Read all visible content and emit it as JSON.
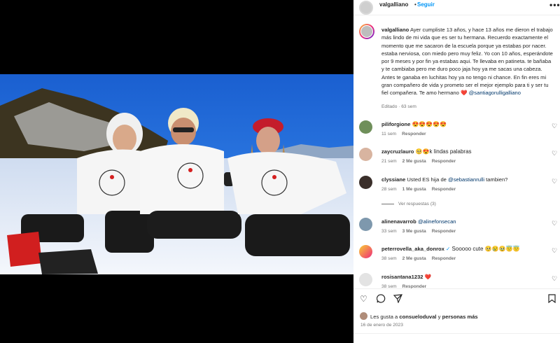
{
  "post": {
    "username": "valgalliano",
    "separator": "•",
    "follow_label": "Seguir",
    "more_label": "•••",
    "caption_user": "valgalliano",
    "caption_text": "Ayer cumpliste 13 años, y hace 13 años me dieron el trabajo más lindo de mi vida que es ser tu hermana. Recuerdo exactamente el momento que me sacaron de la escuela porque ya estabas por nacer. estaba nerviosa, con miedo pero muy feliz. Yo con 10 años, esperándote por 9 meses y por fin ya estabas aqui. Te llevaba en patineta. te bañaba y te cambiaba pero me duro poco jaja hoy ya me sacas una cabeza. Antes te ganaba en luchitas hoy ya no tengo ni chance. En fin eres mi gran compañero de vida y prometo ser el mejor ejemplo para ti y ser tu fiel compañera. Te amo hermano",
    "caption_heart": "❤️",
    "caption_mention": "@santiagorulligalliano",
    "caption_meta": "Editado · 63 sem"
  },
  "comments": [
    {
      "user": "piliforgione",
      "text": "😍😍😍😍😍",
      "time": "11 sem",
      "likes": "",
      "reply": "Responder"
    },
    {
      "user": "zaycruzlauro",
      "text": "🥺😍k lindas palabras",
      "time": "21 sem",
      "likes": "2 Me gusta",
      "reply": "Responder"
    },
    {
      "user": "clyssiane",
      "text": "Usted ES hija de ",
      "mention": "@sebastianrulli",
      "text2": " tambien?",
      "time": "28 sem",
      "likes": "1 Me gusta",
      "reply": "Responder"
    },
    {
      "user": "alinenavarrob",
      "text": "",
      "mention": "@alinefonsecan",
      "time": "33 sem",
      "likes": "3 Me gusta",
      "reply": "Responder"
    },
    {
      "user": "peterrovella_aka_donrox",
      "verified": "✓",
      "text": "Sooooo cute 🥺😢🥹😇😇",
      "time": "38 sem",
      "likes": "2 Me gusta",
      "reply": "Responder"
    },
    {
      "user": "rosisantana1232",
      "text": "❤️",
      "time": "38 sem",
      "likes": "",
      "reply": "Responder"
    }
  ],
  "replies_label": "Ver respuestas (3)",
  "likes_text_prefix": "Les gusta a ",
  "likes_user": "consueloduval",
  "likes_connector": " y ",
  "likes_others": "personas más",
  "date": "16 de enero de 2023",
  "icons": [
    "heart-icon",
    "comment-icon",
    "share-icon",
    "bookmark-icon"
  ]
}
